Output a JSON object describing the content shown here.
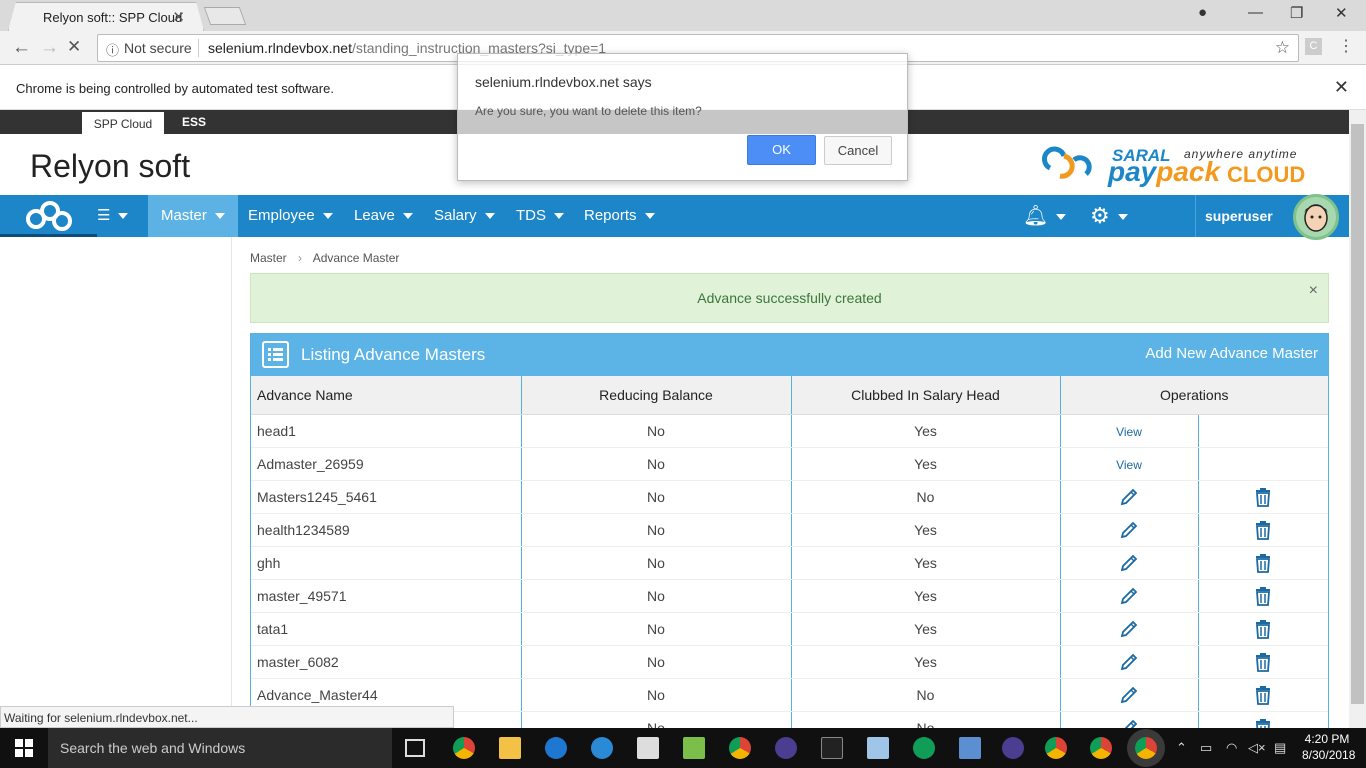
{
  "browser": {
    "tab_title": "Relyon soft:: SPP Cloud",
    "not_secure": "Not secure",
    "url_domain": "selenium.rlndevbox.net",
    "url_path": "/standing_instruction_masters?si_type=1",
    "infobar_text": "Chrome is being controlled by automated test software.",
    "status_text": "Waiting for selenium.rlndevbox.net..."
  },
  "dialog": {
    "title": "selenium.rlndevbox.net says",
    "message": "Are you sure, you want to delete this item?",
    "ok_label": "OK",
    "cancel_label": "Cancel"
  },
  "app": {
    "topbar_tabs": [
      "SPP Cloud",
      "ESS"
    ],
    "company_name": "Relyon soft",
    "logo": {
      "saral": "SARAL",
      "tagline": "anywhere anytime",
      "pay": "pay",
      "pack": "pack",
      "cloud": "CLOUD"
    },
    "nav": [
      "Master",
      "Employee",
      "Leave",
      "Salary",
      "TDS",
      "Reports"
    ],
    "username": "superuser"
  },
  "breadcrumb": {
    "root": "Master",
    "sep": "›",
    "current": "Advance Master"
  },
  "alert": {
    "text": "Advance successfully created",
    "close": "×"
  },
  "panel": {
    "title": "Listing Advance Masters",
    "add_label": "Add New Advance Master",
    "columns": [
      "Advance Name",
      "Reducing Balance",
      "Clubbed In Salary Head",
      "Operations"
    ],
    "rows": [
      {
        "name": "head1",
        "reducing": "No",
        "clubbed": "Yes",
        "op": "view"
      },
      {
        "name": "Admaster_26959",
        "reducing": "No",
        "clubbed": "Yes",
        "op": "view"
      },
      {
        "name": "Masters1245_5461",
        "reducing": "No",
        "clubbed": "No",
        "op": "edit"
      },
      {
        "name": "health1234589",
        "reducing": "No",
        "clubbed": "Yes",
        "op": "edit"
      },
      {
        "name": "ghh",
        "reducing": "No",
        "clubbed": "Yes",
        "op": "edit"
      },
      {
        "name": "master_49571",
        "reducing": "No",
        "clubbed": "Yes",
        "op": "edit"
      },
      {
        "name": "tata1",
        "reducing": "No",
        "clubbed": "Yes",
        "op": "edit"
      },
      {
        "name": "master_6082",
        "reducing": "No",
        "clubbed": "Yes",
        "op": "edit"
      },
      {
        "name": "Advance_Master44",
        "reducing": "No",
        "clubbed": "No",
        "op": "edit"
      },
      {
        "name": "",
        "reducing": "No",
        "clubbed": "No",
        "op": "edit"
      }
    ],
    "view_label": "View"
  },
  "taskbar": {
    "search_text": "Search the web and Windows",
    "time": "4:20 PM",
    "date": "8/30/2018"
  },
  "colors": {
    "nav_blue": "#1c86c8",
    "panel_blue": "#5cb3e6",
    "ok_blue": "#4c8ef5",
    "brand_orange": "#f39a1e"
  }
}
